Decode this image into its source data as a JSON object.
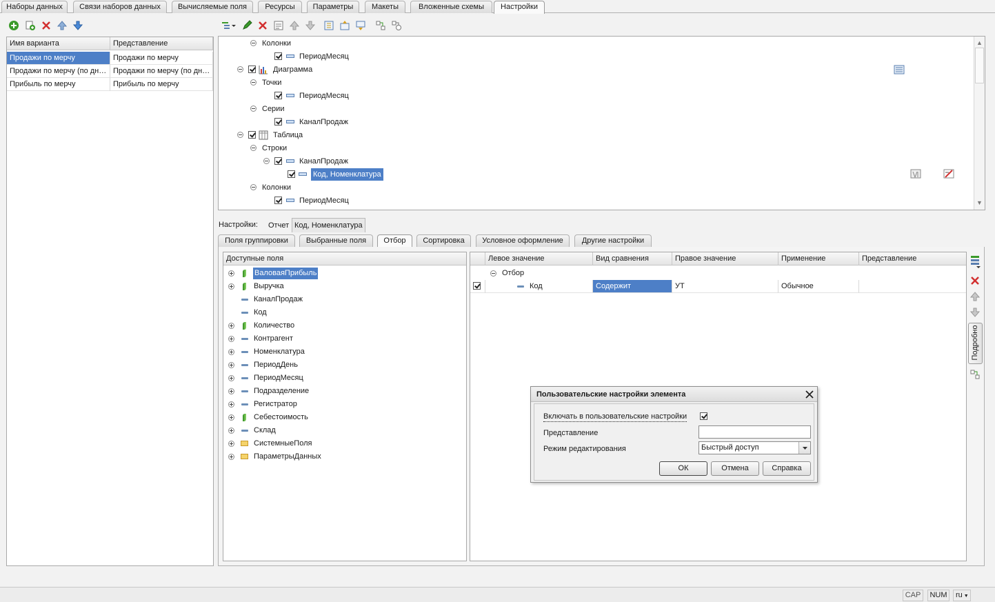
{
  "tabs": [
    "Наборы данных",
    "Связи наборов данных",
    "Вычисляемые поля",
    "Ресурсы",
    "Параметры",
    "Макеты",
    "Вложенные схемы",
    "Настройки"
  ],
  "variants": {
    "headers": [
      "Имя варианта",
      "Представление"
    ],
    "rows": [
      [
        "Продажи по мерчу",
        "Продажи по мерчу"
      ],
      [
        "Продажи по мерчу (по дня…",
        "Продажи по мерчу (по дня…"
      ],
      [
        "Прибыль по мерчу",
        "Прибыль по мерчу"
      ]
    ]
  },
  "structure_tree": [
    {
      "label": "Колонки",
      "type": "group"
    },
    {
      "label": "ПериодМесяц",
      "type": "field"
    },
    {
      "label": "Диаграмма",
      "type": "chart"
    },
    {
      "label": "Точки",
      "type": "group"
    },
    {
      "label": "ПериодМесяц",
      "type": "field"
    },
    {
      "label": "Серии",
      "type": "group"
    },
    {
      "label": "КаналПродаж",
      "type": "field"
    },
    {
      "label": "Таблица",
      "type": "table"
    },
    {
      "label": "Строки",
      "type": "group"
    },
    {
      "label": "КаналПродаж",
      "type": "field"
    },
    {
      "label": "Код, Номенклатура",
      "type": "field"
    },
    {
      "label": "Колонки",
      "type": "group"
    },
    {
      "label": "ПериодМесяц",
      "type": "field"
    }
  ],
  "settings_bar": {
    "label": "Настройки:",
    "report": "Отчет",
    "current": "Код, Номенклатура"
  },
  "subtabs": [
    "Поля группировки",
    "Выбранные поля",
    "Отбор",
    "Сортировка",
    "Условное оформление",
    "Другие настройки"
  ],
  "available_fields": {
    "header": "Доступные поля",
    "items": [
      {
        "label": "ВаловаяПрибыль",
        "icon": "resource",
        "expand": true
      },
      {
        "label": "Выручка",
        "icon": "resource",
        "expand": true
      },
      {
        "label": "КаналПродаж",
        "icon": "field",
        "expand": false
      },
      {
        "label": "Код",
        "icon": "field",
        "expand": false
      },
      {
        "label": "Количество",
        "icon": "resource",
        "expand": true
      },
      {
        "label": "Контрагент",
        "icon": "field",
        "expand": true
      },
      {
        "label": "Номенклатура",
        "icon": "field",
        "expand": true
      },
      {
        "label": "ПериодДень",
        "icon": "field",
        "expand": true
      },
      {
        "label": "ПериодМесяц",
        "icon": "field",
        "expand": true
      },
      {
        "label": "Подразделение",
        "icon": "field",
        "expand": true
      },
      {
        "label": "Регистратор",
        "icon": "field",
        "expand": true
      },
      {
        "label": "Себестоимость",
        "icon": "resource",
        "expand": true
      },
      {
        "label": "Склад",
        "icon": "field",
        "expand": true
      },
      {
        "label": "СистемныеПоля",
        "icon": "folder",
        "expand": true
      },
      {
        "label": "ПараметрыДанных",
        "icon": "folder",
        "expand": true
      }
    ]
  },
  "filter": {
    "headers": [
      "Левое значение",
      "Вид сравнения",
      "Правое значение",
      "Применение",
      "Представление"
    ],
    "group": "Отбор",
    "row": {
      "left": "Код",
      "comparison": "Содержит",
      "right": "УТ",
      "usage": "Обычное",
      "presentation": ""
    }
  },
  "side_vertical_tab": "Подробно",
  "dialog": {
    "title": "Пользовательские настройки элемента",
    "include_label": "Включать в пользовательские настройки",
    "presentation_label": "Представление",
    "presentation_value": "",
    "mode_label": "Режим редактирования",
    "mode_value": "Быстрый доступ",
    "ok": "ОК",
    "cancel": "Отмена",
    "help": "Справка"
  },
  "status": {
    "cap": "CAP",
    "num": "NUM",
    "lang": "ru"
  }
}
